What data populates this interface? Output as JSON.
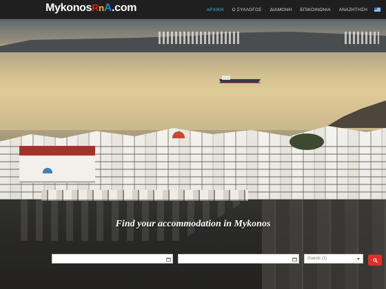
{
  "brand": {
    "part1": "Mykonos",
    "part2": "R",
    "part3": "n",
    "part4": "A",
    "part5": ".com"
  },
  "nav": {
    "items": [
      {
        "label": "ΑΡΧΙΚΗ",
        "active": true
      },
      {
        "label": "Ο ΣΥΛΛΟΓΟΣ",
        "active": false
      },
      {
        "label": "ΔΙΑΜΟΝΗ",
        "active": false
      },
      {
        "label": "ΕΠΙΚΟΙΝΩΝΙΑ",
        "active": false
      },
      {
        "label": "ΑΝΑΖΗΤΗΣΗ",
        "active": false
      }
    ],
    "language_flag": "greek-flag-icon"
  },
  "hero": {
    "tagline": "Find your accommodation in Mykonos"
  },
  "search": {
    "checkin_value": "",
    "checkout_value": "",
    "guests_selected": "Guests (1)",
    "search_icon": "search-icon"
  },
  "colors": {
    "nav_bg": "#1f1f1f",
    "nav_active": "#4fb3e8",
    "search_button": "#e02f28"
  }
}
